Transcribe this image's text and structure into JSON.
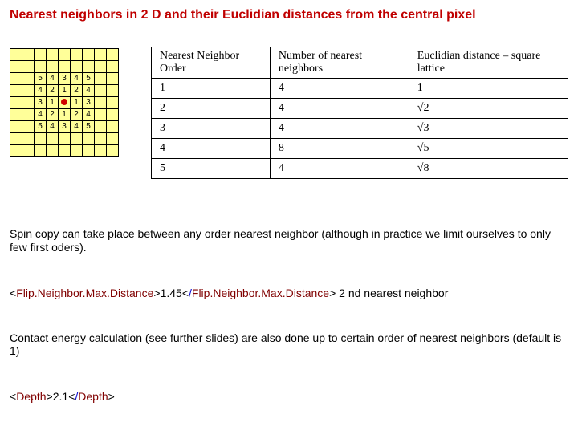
{
  "title": "Nearest neighbors in 2 D and their Euclidian distances from the central pixel",
  "pixel_grid": {
    "rows": [
      [
        "",
        "",
        "",
        "",
        "",
        "",
        "",
        "",
        ""
      ],
      [
        "",
        "",
        "",
        "",
        "",
        "",
        "",
        "",
        ""
      ],
      [
        "",
        "",
        "5",
        "4",
        "3",
        "4",
        "5",
        "",
        ""
      ],
      [
        "",
        "",
        "4",
        "2",
        "1",
        "2",
        "4",
        "",
        ""
      ],
      [
        "",
        "",
        "3",
        "1",
        "•",
        "1",
        "3",
        "",
        ""
      ],
      [
        "",
        "",
        "4",
        "2",
        "1",
        "2",
        "4",
        "",
        ""
      ],
      [
        "",
        "",
        "5",
        "4",
        "3",
        "4",
        "5",
        "",
        ""
      ],
      [
        "",
        "",
        "",
        "",
        "",
        "",
        "",
        "",
        ""
      ],
      [
        "",
        "",
        "",
        "",
        "",
        "",
        "",
        "",
        ""
      ]
    ]
  },
  "info_table": {
    "headers": [
      "Nearest Neighbor Order",
      "Number of nearest neighbors",
      "Euclidian distance – square lattice"
    ],
    "rows": [
      {
        "order": "1",
        "count": "4",
        "dist": "1"
      },
      {
        "order": "2",
        "count": "4",
        "dist": "√2"
      },
      {
        "order": "3",
        "count": "4",
        "dist": "√3"
      },
      {
        "order": "4",
        "count": "8",
        "dist": "√5"
      },
      {
        "order": "5",
        "count": "4",
        "dist": "√8"
      }
    ]
  },
  "para1": "Spin copy can take place between any order nearest neighbor (although in practice we limit ourselves to only few first oders).",
  "xml1": {
    "tag": "Flip.Neighbor.Max.Distance",
    "value": "1.45",
    "suffix": " 2 nd nearest neighbor"
  },
  "para2": "Contact energy calculation (see further slides) are also done up to certain order of nearest neighbors (default is 1)",
  "xml2": {
    "tag": "Depth",
    "value": "2.1",
    "suffix": ""
  }
}
